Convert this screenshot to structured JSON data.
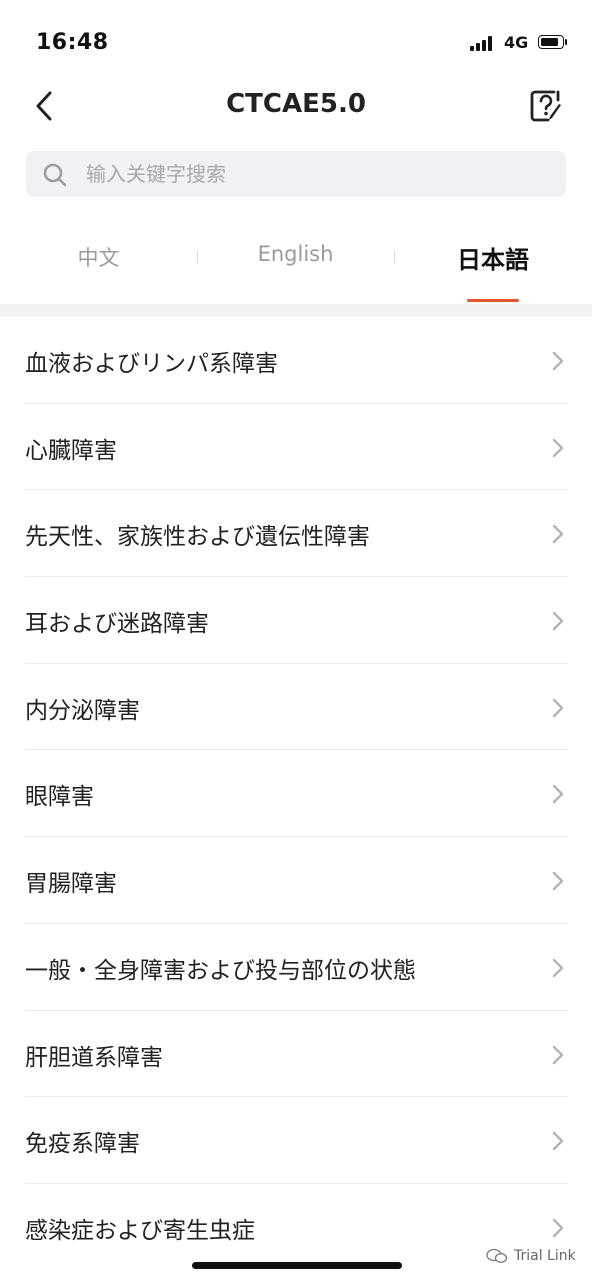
{
  "status_bar": {
    "time": "16:48",
    "network": "4G"
  },
  "nav": {
    "title": "CTCAE5.0",
    "back_icon": "chevron-left-icon",
    "help_icon": "help-edit-icon"
  },
  "search": {
    "placeholder": "输入关键字搜索",
    "value": ""
  },
  "tabs": [
    {
      "label": "中文",
      "active": false
    },
    {
      "label": "English",
      "active": false
    },
    {
      "label": "日本語",
      "active": true
    }
  ],
  "accent_color": "#e4572e",
  "list": {
    "items": [
      {
        "label": "血液およびリンパ系障害"
      },
      {
        "label": "心臓障害"
      },
      {
        "label": "先天性、家族性および遺伝性障害"
      },
      {
        "label": "耳および迷路障害"
      },
      {
        "label": "内分泌障害"
      },
      {
        "label": "眼障害"
      },
      {
        "label": "胃腸障害"
      },
      {
        "label": "一般・全身障害および投与部位の状態"
      },
      {
        "label": "肝胆道系障害"
      },
      {
        "label": "免疫系障害"
      },
      {
        "label": "感染症および寄生虫症"
      }
    ]
  },
  "watermark": {
    "text": "Trial Link"
  }
}
